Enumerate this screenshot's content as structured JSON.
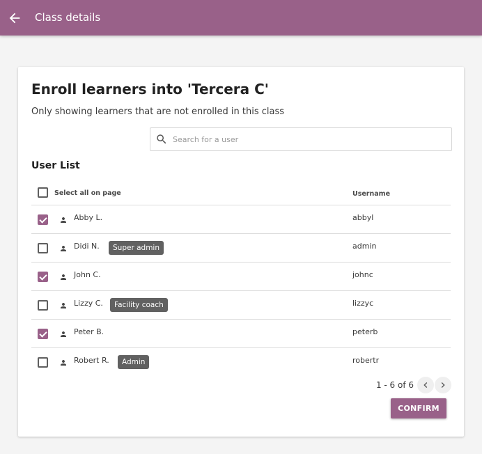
{
  "appbar": {
    "back_icon": "arrow-left-icon",
    "title": "Class details",
    "color": "#996189"
  },
  "card": {
    "title": "Enroll learners into 'Tercera C'",
    "subtitle": "Only showing learners that are not enrolled in this class"
  },
  "search": {
    "icon": "search-icon",
    "placeholder": "Search for a user",
    "value": ""
  },
  "user_list": {
    "title": "User List",
    "header": {
      "select_all_label": "Select all on page",
      "username_label": "Username",
      "select_all_checked": false
    },
    "rows": [
      {
        "name": "Abby L.",
        "badge": "",
        "username": "abbyl",
        "checked": true
      },
      {
        "name": "Didi N.",
        "badge": "Super admin",
        "username": "admin",
        "checked": false
      },
      {
        "name": "John C.",
        "badge": "",
        "username": "johnc",
        "checked": true
      },
      {
        "name": "Lizzy C.",
        "badge": "Facility coach",
        "username": "lizzyc",
        "checked": false
      },
      {
        "name": "Peter B.",
        "badge": "",
        "username": "peterb",
        "checked": true
      },
      {
        "name": "Robert R.",
        "badge": "Admin",
        "username": "robertr",
        "checked": false
      }
    ]
  },
  "pagination": {
    "range_text": "1 - 6 of 6",
    "prev_icon": "chevron-left-icon",
    "next_icon": "chevron-right-icon"
  },
  "actions": {
    "confirm_label": "CONFIRM"
  }
}
